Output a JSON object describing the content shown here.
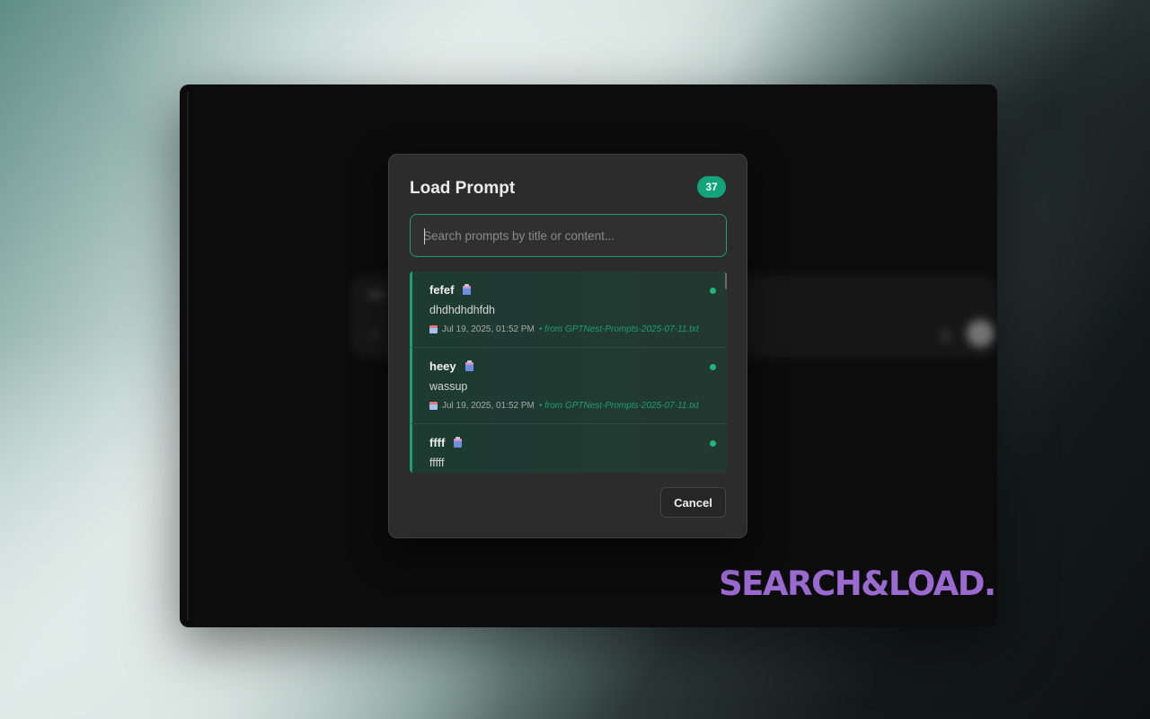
{
  "modal": {
    "title": "Load Prompt",
    "count": "37",
    "search_placeholder": "Search prompts by title or content...",
    "search_value": "",
    "cancel_label": "Cancel"
  },
  "prompts": [
    {
      "title": "fefef",
      "content": "dhdhdhdhfdh",
      "date": "Jul 19, 2025, 01:52 PM",
      "source": "• from GPTNest-Prompts-2025-07-11.txt"
    },
    {
      "title": "heey",
      "content": "wassup",
      "date": "Jul 19, 2025, 01:52 PM",
      "source": "• from GPTNest-Prompts-2025-07-11.txt"
    },
    {
      "title": "ffff",
      "content": "fffff",
      "date": "",
      "source": ""
    }
  ],
  "brand": {
    "text": "SEARCH&LOAD."
  },
  "icons": {
    "prompt_type": "clipboard-icon",
    "date": "calendar-icon",
    "status": "status-dot"
  },
  "colors": {
    "accent": "#12a37a",
    "brand": "#9b6ad1",
    "modal_bg": "#2c2c2c",
    "item_bg": "#1d3b31"
  }
}
